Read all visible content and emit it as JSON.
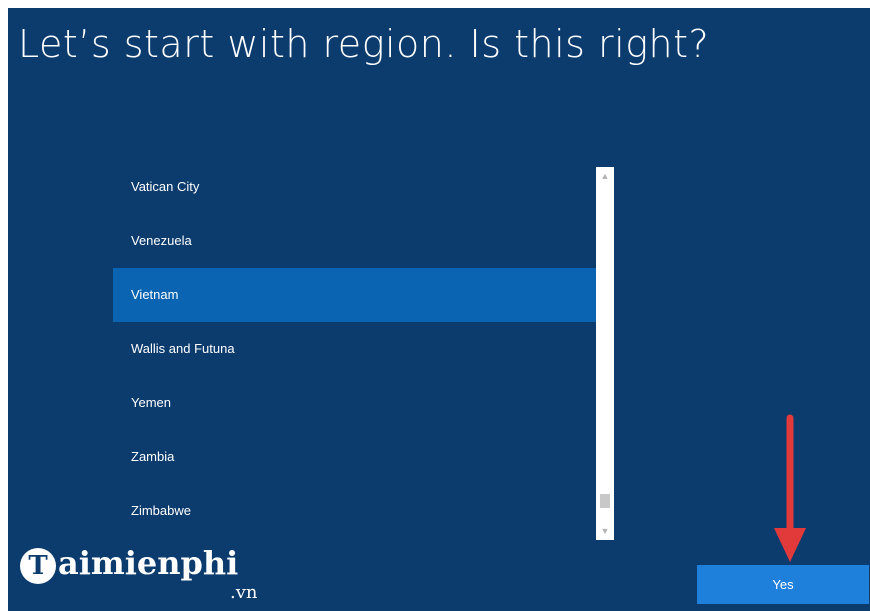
{
  "title": "Let’s start with region. Is this right?",
  "regions": [
    "Vatican City",
    "Venezuela",
    "Vietnam",
    "Wallis and Futuna",
    "Yemen",
    "Zambia",
    "Zimbabwe"
  ],
  "selected_region": "Vietnam",
  "scrollbar": {
    "position": 0.95
  },
  "yes_button": {
    "label": "Yes"
  },
  "watermark": {
    "mark": "T",
    "word": "aimienphi",
    "tld": ".vn"
  },
  "colors": {
    "background": "#0c3b6e",
    "selected_row": "#0a64b2",
    "button": "#1f80dc",
    "annotation_arrow": "#e23a3a"
  },
  "icons": {
    "scroll_up": "chevron-up-icon",
    "scroll_down": "chevron-down-icon",
    "annotation": "red-down-arrow-icon"
  }
}
